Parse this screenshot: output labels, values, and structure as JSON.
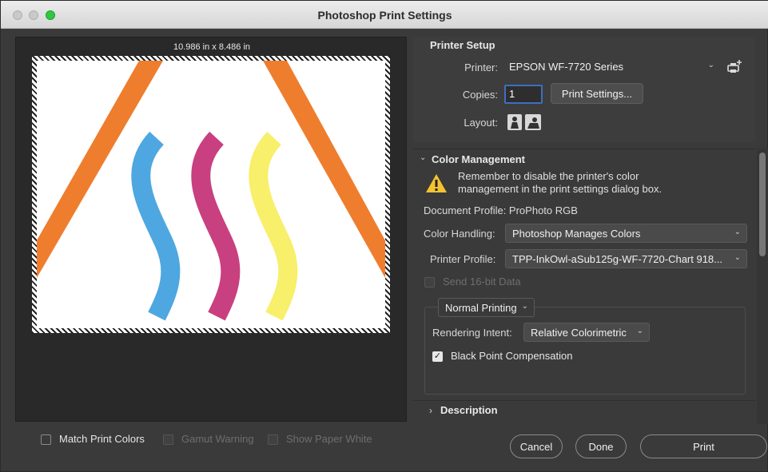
{
  "window": {
    "title": "Photoshop Print Settings"
  },
  "preview": {
    "dimensions": "10.986 in x 8.486 in",
    "options": [
      {
        "label": "Match Print Colors",
        "checked": false,
        "enabled": true
      },
      {
        "label": "Gamut Warning",
        "checked": false,
        "enabled": false
      },
      {
        "label": "Show Paper White",
        "checked": false,
        "enabled": false
      }
    ]
  },
  "printer_setup": {
    "heading": "Printer Setup",
    "printer_label": "Printer:",
    "printer_value": "EPSON WF-7720 Series",
    "copies_label": "Copies:",
    "copies_value": "1",
    "print_settings_button": "Print Settings...",
    "layout_label": "Layout:"
  },
  "color_management": {
    "heading": "Color Management",
    "warning_line1": "Remember to disable the printer's color",
    "warning_line2": "management in the print settings dialog box.",
    "document_profile": "Document Profile: ProPhoto RGB",
    "color_handling_label": "Color Handling:",
    "color_handling_value": "Photoshop Manages Colors",
    "printer_profile_label": "Printer Profile:",
    "printer_profile_value": "TPP-InkOwl-aSub125g-WF-7720-Chart 918...",
    "send16_label": "Send 16-bit Data",
    "printing_mode": "Normal Printing",
    "rendering_intent_label": "Rendering Intent:",
    "rendering_intent_value": "Relative Colorimetric",
    "black_point_label": "Black Point Compensation",
    "black_point_checked": true
  },
  "description": {
    "heading": "Description"
  },
  "footer": {
    "cancel": "Cancel",
    "done": "Done",
    "print": "Print"
  },
  "colors": {
    "accent_focus": "#3e6fbf",
    "art_orange": "#ef7d2e",
    "art_blue": "#4ea7e0",
    "art_magenta": "#c8407f",
    "art_yellow": "#f8ef6a",
    "warning_yellow": "#f2c230"
  }
}
